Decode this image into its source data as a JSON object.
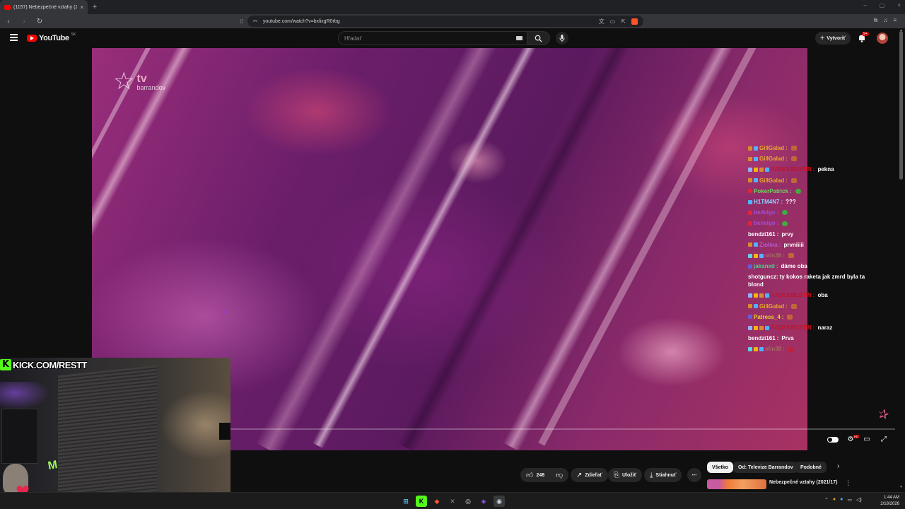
{
  "browser": {
    "tab_title": "(1157) Nebezpečné vztahy (20...",
    "tab_close": "×",
    "new_tab": "+",
    "url": "youtube.com/watch?v=bxlixgR0rbg",
    "window_controls": [
      "–",
      "▢",
      "×"
    ]
  },
  "youtube": {
    "logo_text": "YouTube",
    "region": "SK",
    "search_placeholder": "Hľadať",
    "create_label": "Vytvoriť",
    "notifications_badge": "9+"
  },
  "video": {
    "channel_logo_tv": "tv",
    "channel_logo_name": "barrandov"
  },
  "chat": [
    {
      "user": "GillGalad",
      "color": "#e6a92c",
      "msg": "",
      "icons": [
        "#d98c2b",
        "#4fb3ff"
      ],
      "emote": "orange"
    },
    {
      "user": "GillGalad",
      "color": "#e6a92c",
      "msg": "",
      "icons": [
        "#d98c2b",
        "#4fb3ff"
      ],
      "emote": "orange"
    },
    {
      "user": "RADEKBESTIN",
      "color": "#d0101a",
      "msg": "pekna",
      "icons": [
        "#8fb3ff",
        "#f2b705",
        "#d98c2b",
        "#4fb3ff"
      ],
      "emote": ""
    },
    {
      "user": "GillGalad",
      "color": "#e6a92c",
      "msg": "",
      "icons": [
        "#d98c2b",
        "#4fb3ff"
      ],
      "emote": "orange"
    },
    {
      "user": "PokerPatrick",
      "color": "#6bd65a",
      "msg": "",
      "icons": [
        "#e0243c"
      ],
      "emote": "green"
    },
    {
      "user": "H1TM4N7",
      "color": "#8fd0ff",
      "msg": "???",
      "icons": [
        "#4fb3ff"
      ],
      "emote": ""
    },
    {
      "user": "bedvigo",
      "color": "#a64fd6",
      "msg": "",
      "icons": [
        "#e0243c"
      ],
      "emote": "green"
    },
    {
      "user": "benvigo",
      "color": "#a64fd6",
      "msg": "",
      "icons": [
        "#e0243c"
      ],
      "emote": "green"
    },
    {
      "user": "bendzi161",
      "color": "#ffffff",
      "msg": "prvy",
      "icons": [],
      "emote": ""
    },
    {
      "user": "Ziolina",
      "color": "#b25bd6",
      "msg": "prvniiiii",
      "icons": [
        "#d98c2b",
        "#4fb3ff"
      ],
      "emote": ""
    },
    {
      "user": "olin38",
      "color": "#a07060",
      "msg": "",
      "icons": [
        "#5fd0e6",
        "#f2b705",
        "#4fb3ff"
      ],
      "emote": "orange"
    },
    {
      "user": "jakanxd",
      "color": "#4fd08a",
      "msg": "dáme oba",
      "icons": [
        "#6a5bd6"
      ],
      "emote": ""
    },
    {
      "user": "shotguncz",
      "color": "#ffffff",
      "msg": "ty kokos raketa jak zmrd byla ta blond",
      "icons": [],
      "emote": "",
      "wrap": true
    },
    {
      "user": "RADEKBESTIN",
      "color": "#d0101a",
      "msg": "oba",
      "icons": [
        "#8fb3ff",
        "#f2b705",
        "#d98c2b",
        "#4fb3ff"
      ],
      "emote": ""
    },
    {
      "user": "GillGalad",
      "color": "#e6a92c",
      "msg": "",
      "icons": [
        "#d98c2b",
        "#4fb3ff"
      ],
      "emote": "orange"
    },
    {
      "user": "Patress_4",
      "color": "#e6d22c",
      "msg": "",
      "icons": [
        "#6a5bd6"
      ],
      "emote": "orange"
    },
    {
      "user": "RADEKBESTIN",
      "color": "#d0101a",
      "msg": "naraz",
      "icons": [
        "#8fb3ff",
        "#f2b705",
        "#d98c2b",
        "#4fb3ff"
      ],
      "emote": ""
    },
    {
      "user": "bendzi161",
      "color": "#ffffff",
      "msg": "Prva",
      "icons": [],
      "emote": ""
    },
    {
      "user": "olin38",
      "color": "#a07060",
      "msg": "",
      "icons": [
        "#5fd0e6",
        "#f2b705",
        "#4fb3ff"
      ],
      "emote": "red"
    }
  ],
  "webcam": {
    "kick_logo": "K",
    "kick_text": "KICK.COM/RESTT"
  },
  "actions": {
    "like_count": "248",
    "share": "Zdieľať",
    "save": "Uložiť",
    "download": "Stiahnuť",
    "more": "⋯"
  },
  "chips": [
    "Všetko",
    "Od: Televize Barrandov",
    "Podobné"
  ],
  "recommendation": {
    "title": "Nebezpečné vztahy (2021/17)"
  },
  "taskbar": {
    "time": "1:44 AM",
    "date": "2/18/2026"
  },
  "colors": {
    "youtube_red": "#ff0000",
    "kick_green": "#53fc18",
    "brave_orange": "#fb542b"
  }
}
